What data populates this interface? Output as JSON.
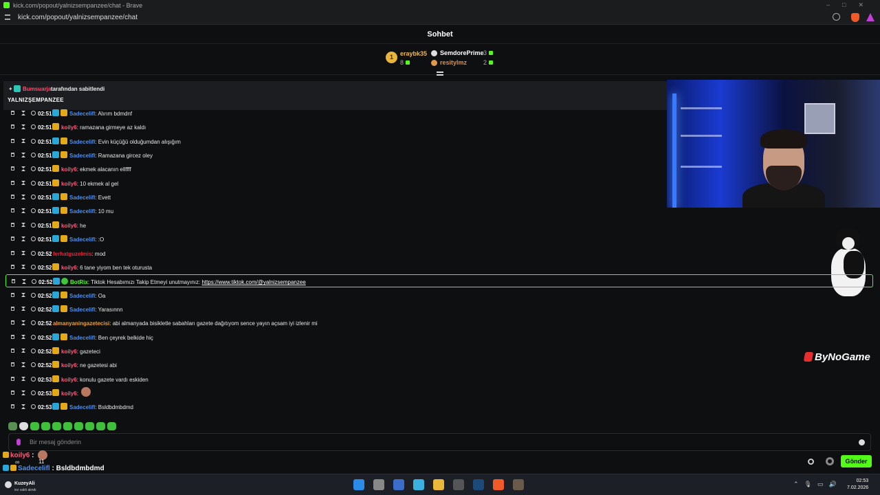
{
  "browser": {
    "window_title": "kick.com/popout/yalnizsempanzee/chat - Brave",
    "url": "kick.com/popout/yalnizsempanzee/chat"
  },
  "chat": {
    "header": "Sohbet",
    "leaderboard": {
      "rank": "1",
      "top": {
        "name": "eraybk35",
        "count": "8"
      },
      "second": {
        "name": "SemdorePrime",
        "count": "3"
      },
      "third": {
        "name": "resitylmz",
        "count": "2"
      }
    },
    "pinned": {
      "pinner": "Bumsuarja",
      "pinned_by_text": "tarafından sabitlendi",
      "message": "YALNIZŞEMPANZEE"
    },
    "messages": [
      {
        "time": "02:51",
        "badges": [
          "sub",
          "crown"
        ],
        "user": "Sadecelifl",
        "color": "#4a8ff0",
        "text": ": Alırım bdmdnf"
      },
      {
        "time": "02:51",
        "badges": [
          "crown"
        ],
        "user": "koily6",
        "color": "#ff5a7a",
        "text": ": ramazana girmeye az kaldı"
      },
      {
        "time": "02:51",
        "badges": [
          "sub",
          "crown"
        ],
        "user": "Sadecelifl",
        "color": "#4a8ff0",
        "text": ": Evin küçüğü olduğumdan alışığım"
      },
      {
        "time": "02:51",
        "badges": [
          "sub",
          "crown"
        ],
        "user": "Sadecelifl",
        "color": "#4a8ff0",
        "text": ": Ramazana gircez oley"
      },
      {
        "time": "02:51",
        "badges": [
          "crown"
        ],
        "user": "koily6",
        "color": "#ff5a7a",
        "text": ": ekmek alacanın ellffff"
      },
      {
        "time": "02:51",
        "badges": [
          "crown"
        ],
        "user": "koily6",
        "color": "#ff5a7a",
        "text": ": 10 ekmek al gel"
      },
      {
        "time": "02:51",
        "badges": [
          "sub",
          "crown"
        ],
        "user": "Sadecelifl",
        "color": "#4a8ff0",
        "text": ": Evett"
      },
      {
        "time": "02:51",
        "badges": [
          "sub",
          "crown"
        ],
        "user": "Sadecelifl",
        "color": "#4a8ff0",
        "text": ": 10 mu"
      },
      {
        "time": "02:51",
        "badges": [
          "crown"
        ],
        "user": "koily6",
        "color": "#ff5a7a",
        "text": ": he"
      },
      {
        "time": "02:51",
        "badges": [
          "sub",
          "crown"
        ],
        "user": "Sadecelifl",
        "color": "#4a8ff0",
        "text": ": :O"
      },
      {
        "time": "02:52",
        "badges": [],
        "user": "ferhatguzelmis",
        "color": "#e8243c",
        "text": ": mod"
      },
      {
        "time": "02:52",
        "badges": [
          "crown"
        ],
        "user": "koily6",
        "color": "#ff5a7a",
        "text": ": 6 tane yiyom ben tek oturusta"
      },
      {
        "time": "02:52",
        "badges": [
          "sub",
          "bot"
        ],
        "user": "BotRix",
        "color": "#53fc18",
        "text": ": Tiktok Hesabımızı Takip Etmeyi unutmayınız: ",
        "link": "https://www.tiktok.com/@yalnizsempanzee",
        "highlight": true
      },
      {
        "time": "02:52",
        "badges": [
          "sub",
          "crown"
        ],
        "user": "Sadecelifl",
        "color": "#4a8ff0",
        "text": ": Oa"
      },
      {
        "time": "02:52",
        "badges": [
          "sub",
          "crown"
        ],
        "user": "Sadecelifl",
        "color": "#4a8ff0",
        "text": ": Yarasınnn"
      },
      {
        "time": "02:52",
        "badges": [],
        "user": "almanyaningazetecisi",
        "color": "#f0a030",
        "text": ": abi almanyada bisikletle sabahları gazete dağıtıyom sence yayın açsam iyi izlenir mi"
      },
      {
        "time": "02:52",
        "badges": [
          "sub",
          "crown"
        ],
        "user": "Sadecelifl",
        "color": "#4a8ff0",
        "text": ": Ben çeyrek belkide hiç"
      },
      {
        "time": "02:52",
        "badges": [
          "crown"
        ],
        "user": "koily6",
        "color": "#ff5a7a",
        "text": ": gazeteci"
      },
      {
        "time": "02:52",
        "badges": [
          "crown"
        ],
        "user": "koily6",
        "color": "#ff5a7a",
        "text": ": ne gazetesi abi"
      },
      {
        "time": "02:53",
        "badges": [
          "crown"
        ],
        "user": "koily6",
        "color": "#ff5a7a",
        "text": ": konulu gazete vardı eskiden"
      },
      {
        "time": "02:53",
        "badges": [
          "crown"
        ],
        "user": "koily6",
        "color": "#ff5a7a",
        "text": ":",
        "emote": true
      },
      {
        "time": "02:53",
        "badges": [
          "sub",
          "crown"
        ],
        "user": "Sadecelifl",
        "color": "#4a8ff0",
        "text": ": Bsldbdmbdmd"
      }
    ],
    "composer_placeholder": "Bir mesaj gönderin",
    "send_label": "Gönder",
    "overlay_brand": "ByNoGame"
  },
  "event_feed": {
    "line1_user": "koily6",
    "line1_text": ":",
    "line2_user": "Sadecelifl",
    "line2_text": ": Bsldbdmbdmd",
    "infinity": "∞",
    "count": "11"
  },
  "taskbar": {
    "user_name": "KuzeyAli",
    "user_status": "iez vakti akndı",
    "time": "02:53",
    "date": "7.02.2026"
  },
  "colors": {
    "kick_green": "#53fc18",
    "sub_badge": "#2aa7d6",
    "crown_badge": "#e3a91a"
  }
}
